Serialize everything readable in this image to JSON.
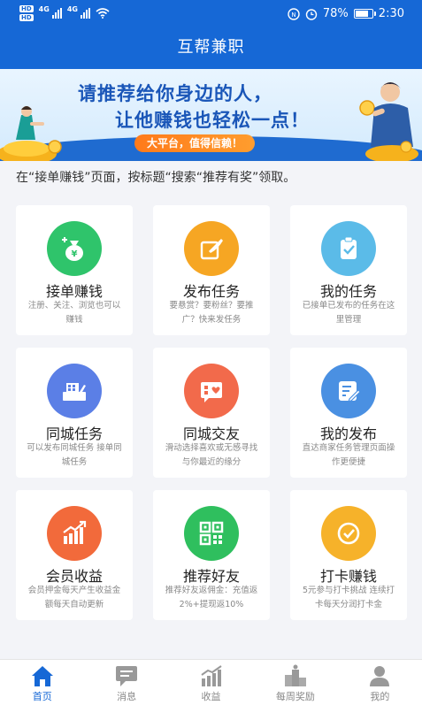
{
  "status_bar": {
    "hd_top": "HD",
    "hd_bottom": "HD",
    "net1": "4G",
    "net2": "4G",
    "battery_percent": "78%",
    "time": "2:30",
    "battery_level": 0.78
  },
  "header": {
    "title": "互帮兼职"
  },
  "banner": {
    "line1": "请推荐给你身边的人，",
    "line2": "让他赚钱也轻松一点！",
    "pill": "大平台，值得信赖！"
  },
  "tip": "在“接单赚钱”页面，按标题“搜索“推荐有奖”领取。",
  "cards": [
    {
      "title": "接单赚钱",
      "desc": "注册、关注、浏览也可以赚钱",
      "icon": "money-bag-icon",
      "color": "#2fc46b"
    },
    {
      "title": "发布任务",
      "desc": "要悬赏？要粉丝？要推广？快来发任务",
      "icon": "publish-icon",
      "color": "#f6a623"
    },
    {
      "title": "我的任务",
      "desc": "已接单已发布的任务在这里管理",
      "icon": "clipboard-icon",
      "color": "#5bbbe8"
    },
    {
      "title": "同城任务",
      "desc": "可以发布同城任务 接单同城任务",
      "icon": "shop-icon",
      "color": "#5b7fe6"
    },
    {
      "title": "同城交友",
      "desc": "滑动选择喜欢或无感寻找与你最近的缘分",
      "icon": "heart-chat-icon",
      "color": "#f26a4b"
    },
    {
      "title": "我的发布",
      "desc": "直达商家任务管理页面操作更便捷",
      "icon": "edit-doc-icon",
      "color": "#4a90e2"
    },
    {
      "title": "会员收益",
      "desc": "会员押金每天产生收益金额每天自动更新",
      "icon": "growth-chart-icon",
      "color": "#f26a3b"
    },
    {
      "title": "推荐好友",
      "desc": "推荐好友返佣金：充值返2%+提现返10%",
      "icon": "qr-code-icon",
      "color": "#2fbf5e"
    },
    {
      "title": "打卡赚钱",
      "desc": "5元参与打卡挑战 连续打卡每天分润打卡金",
      "icon": "check-badge-icon",
      "color": "#f6b22a"
    }
  ],
  "tabs": [
    {
      "label": "首页",
      "icon": "home-icon",
      "active": true
    },
    {
      "label": "消息",
      "icon": "message-icon",
      "active": false
    },
    {
      "label": "收益",
      "icon": "earnings-chart-icon",
      "active": false
    },
    {
      "label": "每周奖励",
      "icon": "podium-icon",
      "active": false
    },
    {
      "label": "我的",
      "icon": "user-icon",
      "active": false
    }
  ],
  "colors": {
    "primary": "#1668d6",
    "tab_inactive": "#888888"
  }
}
